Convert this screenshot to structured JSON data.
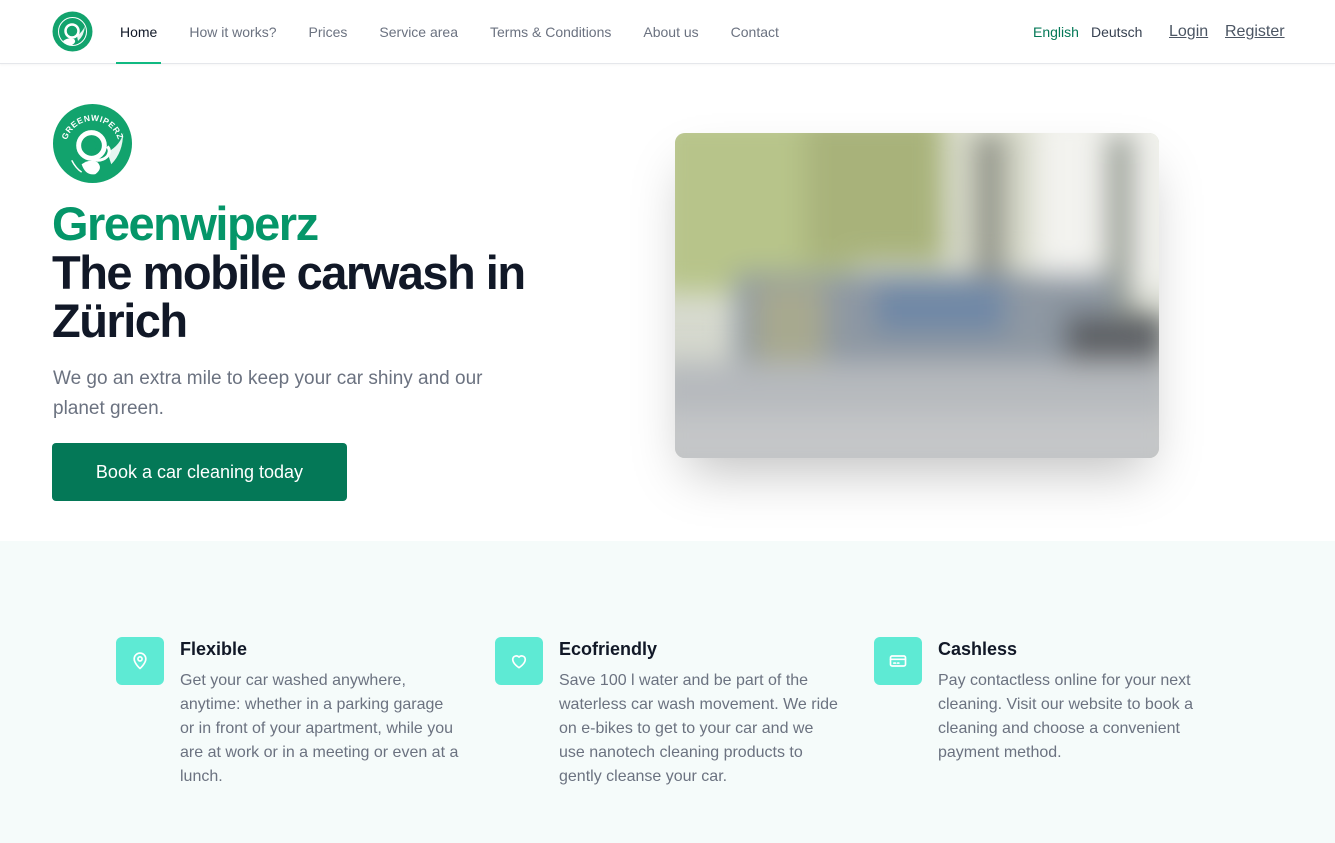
{
  "nav": {
    "logo_icon": "greenwiperz-logo-icon",
    "links": [
      {
        "label": "Home",
        "active": true
      },
      {
        "label": "How it works?"
      },
      {
        "label": "Prices"
      },
      {
        "label": "Service area"
      },
      {
        "label": "Terms & Conditions"
      },
      {
        "label": "About us"
      },
      {
        "label": "Contact"
      }
    ],
    "languages": {
      "english": "English",
      "deutsch": "Deutsch",
      "active": "English"
    },
    "auth": {
      "login": "Login",
      "register": "Register"
    }
  },
  "hero": {
    "logo_text": "GREENWIPERZ",
    "brand": "Greenwiperz",
    "title": "The mobile carwash in Zürich",
    "subtitle": "We go an extra mile to keep your car shiny and our planet green.",
    "cta_label": "Book a car cleaning today",
    "image": "blurred-street-car-image"
  },
  "features": [
    {
      "icon": "map-pin-icon",
      "title": "Flexible",
      "text": "Get your car washed anywhere, anytime: whether in a parking garage or in front of your apartment, while you are at work or in a meeting or even at a lunch."
    },
    {
      "icon": "heart-icon",
      "title": "Ecofriendly",
      "text": "Save 100 l water and be part of the waterless car wash movement. We ride on e-bikes to get to your car and we use nanotech cleaning products to gently cleanse your car."
    },
    {
      "icon": "credit-card-icon",
      "title": "Cashless",
      "text": "Pay contactless online for your next cleaning. Visit our website to book a cleaning and choose a convenient payment method."
    }
  ],
  "colors": {
    "brand_green": "#059669",
    "button_green": "#047857",
    "icon_teal": "#5eead4",
    "features_bg": "#f5fbfa"
  }
}
